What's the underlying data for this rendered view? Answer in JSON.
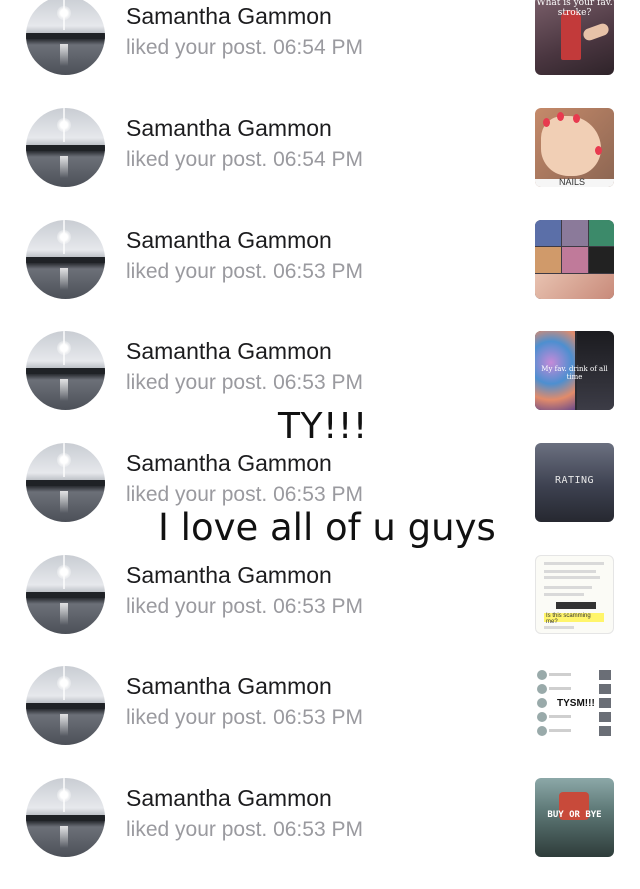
{
  "notifications": [
    {
      "name": "Samantha Gammon",
      "text": "liked your post. 06:54 PM",
      "thumb_caption": "What is your fav. stroke?"
    },
    {
      "name": "Samantha Gammon",
      "text": "liked your post. 06:54 PM",
      "thumb_caption": "NAILS"
    },
    {
      "name": "Samantha Gammon",
      "text": "liked your post. 06:53 PM",
      "thumb_caption": ""
    },
    {
      "name": "Samantha Gammon",
      "text": "liked your post. 06:53 PM",
      "thumb_caption": "My fav. drink of all time"
    },
    {
      "name": "Samantha Gammon",
      "text": "liked your post. 06:53 PM",
      "thumb_caption": "RATING"
    },
    {
      "name": "Samantha Gammon",
      "text": "liked your post. 06:53 PM",
      "thumb_caption": "Is this scamming me?"
    },
    {
      "name": "Samantha Gammon",
      "text": "liked your post. 06:53 PM",
      "thumb_caption": "TYSM!!!"
    },
    {
      "name": "Samantha Gammon",
      "text": "liked your post. 06:53 PM",
      "thumb_caption": "BUY OR BYE"
    }
  ],
  "overlay": {
    "line1": "TY!!!",
    "line2": "I love all of u guys"
  },
  "colors": {
    "name_text": "#1c1c1e",
    "meta_text": "#9a9a9f",
    "nail_accent": "#e83a4f"
  }
}
